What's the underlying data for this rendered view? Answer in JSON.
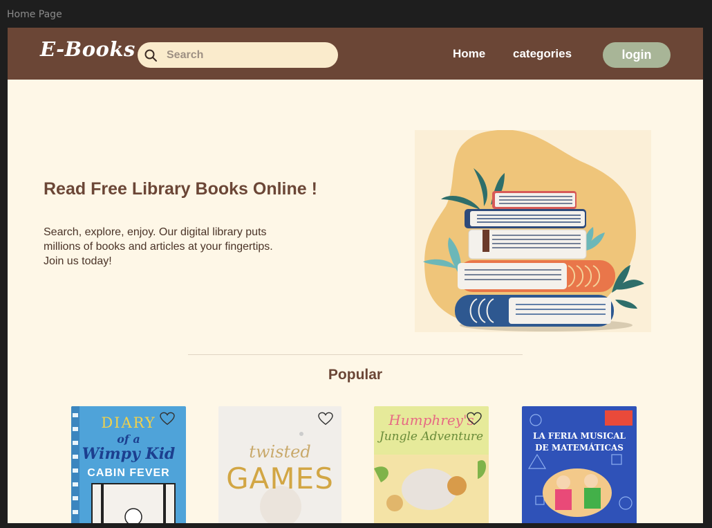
{
  "frame": {
    "label": "Home Page"
  },
  "navbar": {
    "logo": "E-Books",
    "search_placeholder": "Search",
    "links": [
      {
        "label": "Home"
      },
      {
        "label": "categories"
      }
    ],
    "login_label": "login"
  },
  "hero": {
    "title": "Read Free Library Books Online !",
    "description": "Search, explore, enjoy. Our digital library puts millions of books and articles at your fingertips. Join us today!"
  },
  "popular": {
    "title": "Popular",
    "books": [
      {
        "cover_lines": [
          "DIARY",
          "of a",
          "Wimpy Kid",
          "CABIN FEVER"
        ]
      },
      {
        "cover_lines": [
          "twisted",
          "GAMES"
        ]
      },
      {
        "cover_lines": [
          "Humphrey's",
          "Jungle Adventure"
        ]
      },
      {
        "cover_lines": [
          "LA FERIA MUSICAL",
          "DE MATEMÁTICAS"
        ]
      }
    ]
  },
  "colors": {
    "navbar": "#6b4636",
    "background": "#fef7e7",
    "login_button": "#a8b597",
    "search_bg": "#faebcc",
    "heading": "#6b4636"
  },
  "icons": {
    "search": "search-icon",
    "favorite": "heart-icon"
  }
}
